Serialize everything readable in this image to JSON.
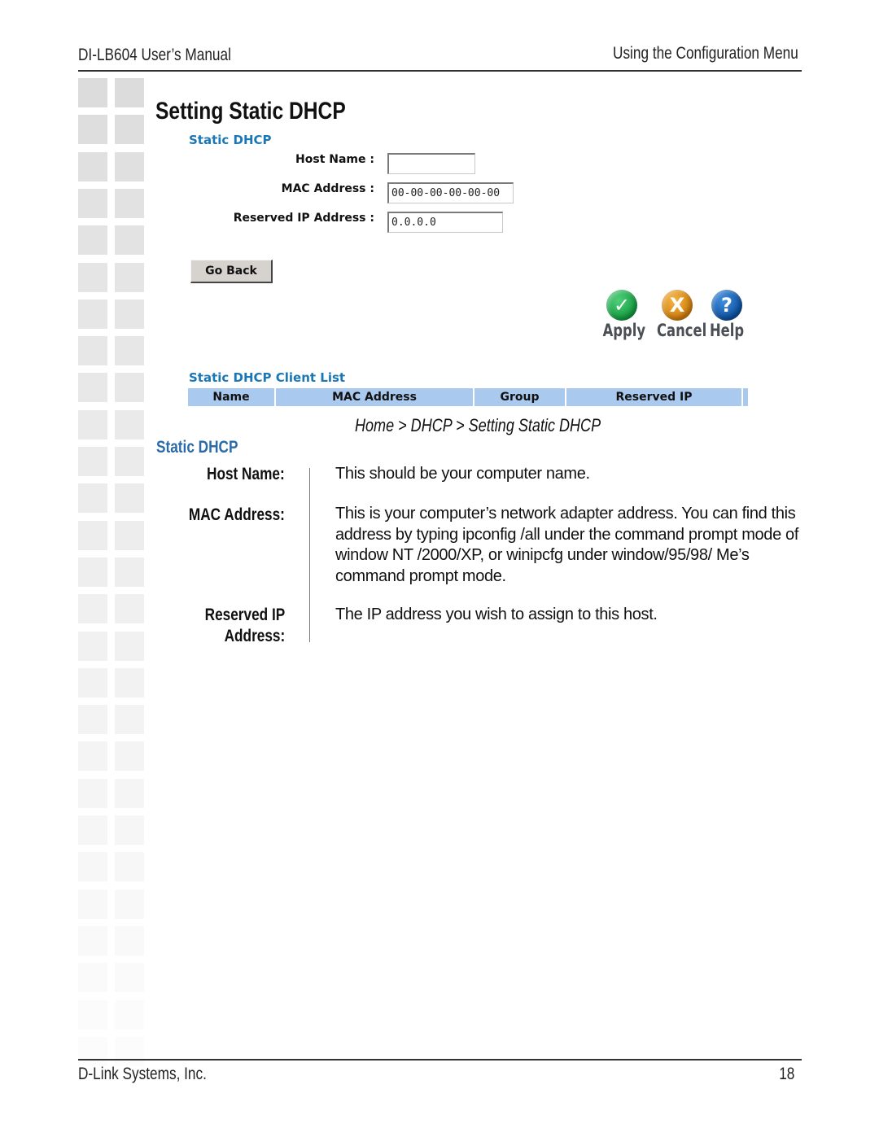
{
  "header": {
    "left": "DI-LB604 User’s Manual",
    "right": "Using the Configuration Menu"
  },
  "page_title": "Setting Static DHCP",
  "screenshot": {
    "panel_title": "Static DHCP",
    "fields": {
      "host_name": {
        "label": "Host Name :",
        "value": ""
      },
      "mac_address": {
        "label": "MAC Address :",
        "value": "00-00-00-00-00-00"
      },
      "reserved_ip": {
        "label": "Reserved IP Address :",
        "value": "0.0.0.0"
      }
    },
    "go_back_label": "Go Back",
    "actions": [
      {
        "name": "apply",
        "label": "Apply",
        "icon": "check-icon",
        "glyph": "✓",
        "color": "#139a3f"
      },
      {
        "name": "cancel",
        "label": "Cancel",
        "icon": "x-icon",
        "glyph": "X",
        "color": "#d07c0c"
      },
      {
        "name": "help",
        "label": "Help",
        "icon": "question-icon",
        "glyph": "?",
        "color": "#0d4f9e"
      }
    ],
    "client_list": {
      "title": "Static DHCP Client List",
      "columns": [
        "Name",
        "MAC Address",
        "Group",
        "Reserved IP"
      ],
      "rows": []
    }
  },
  "caption": "Home > DHCP > Setting Static DHCP",
  "section": {
    "title": "Static DHCP",
    "definitions": [
      {
        "term": "Host Name:",
        "description": "This should be your computer name."
      },
      {
        "term": "MAC Address:",
        "description": "This is your computer’s network adapter address. You can find this address by typing ipconfig /all under the command prompt mode of window NT /2000/XP, or winipcfg under window/95/98/ Me’s command prompt mode."
      },
      {
        "term": "Reserved IP Address:",
        "term_lines": [
          "Reserved IP",
          "Address:"
        ],
        "description": "The IP address you wish to assign to this host."
      }
    ]
  },
  "footer": {
    "left": "D-Link Systems, Inc.",
    "page_number": "18"
  },
  "colors": {
    "ui_title_blue": "#1a77b5",
    "section_blue": "#2a6aa8",
    "table_header_bg": "#a9c9ef",
    "button_bg": "#d6d3ce"
  }
}
